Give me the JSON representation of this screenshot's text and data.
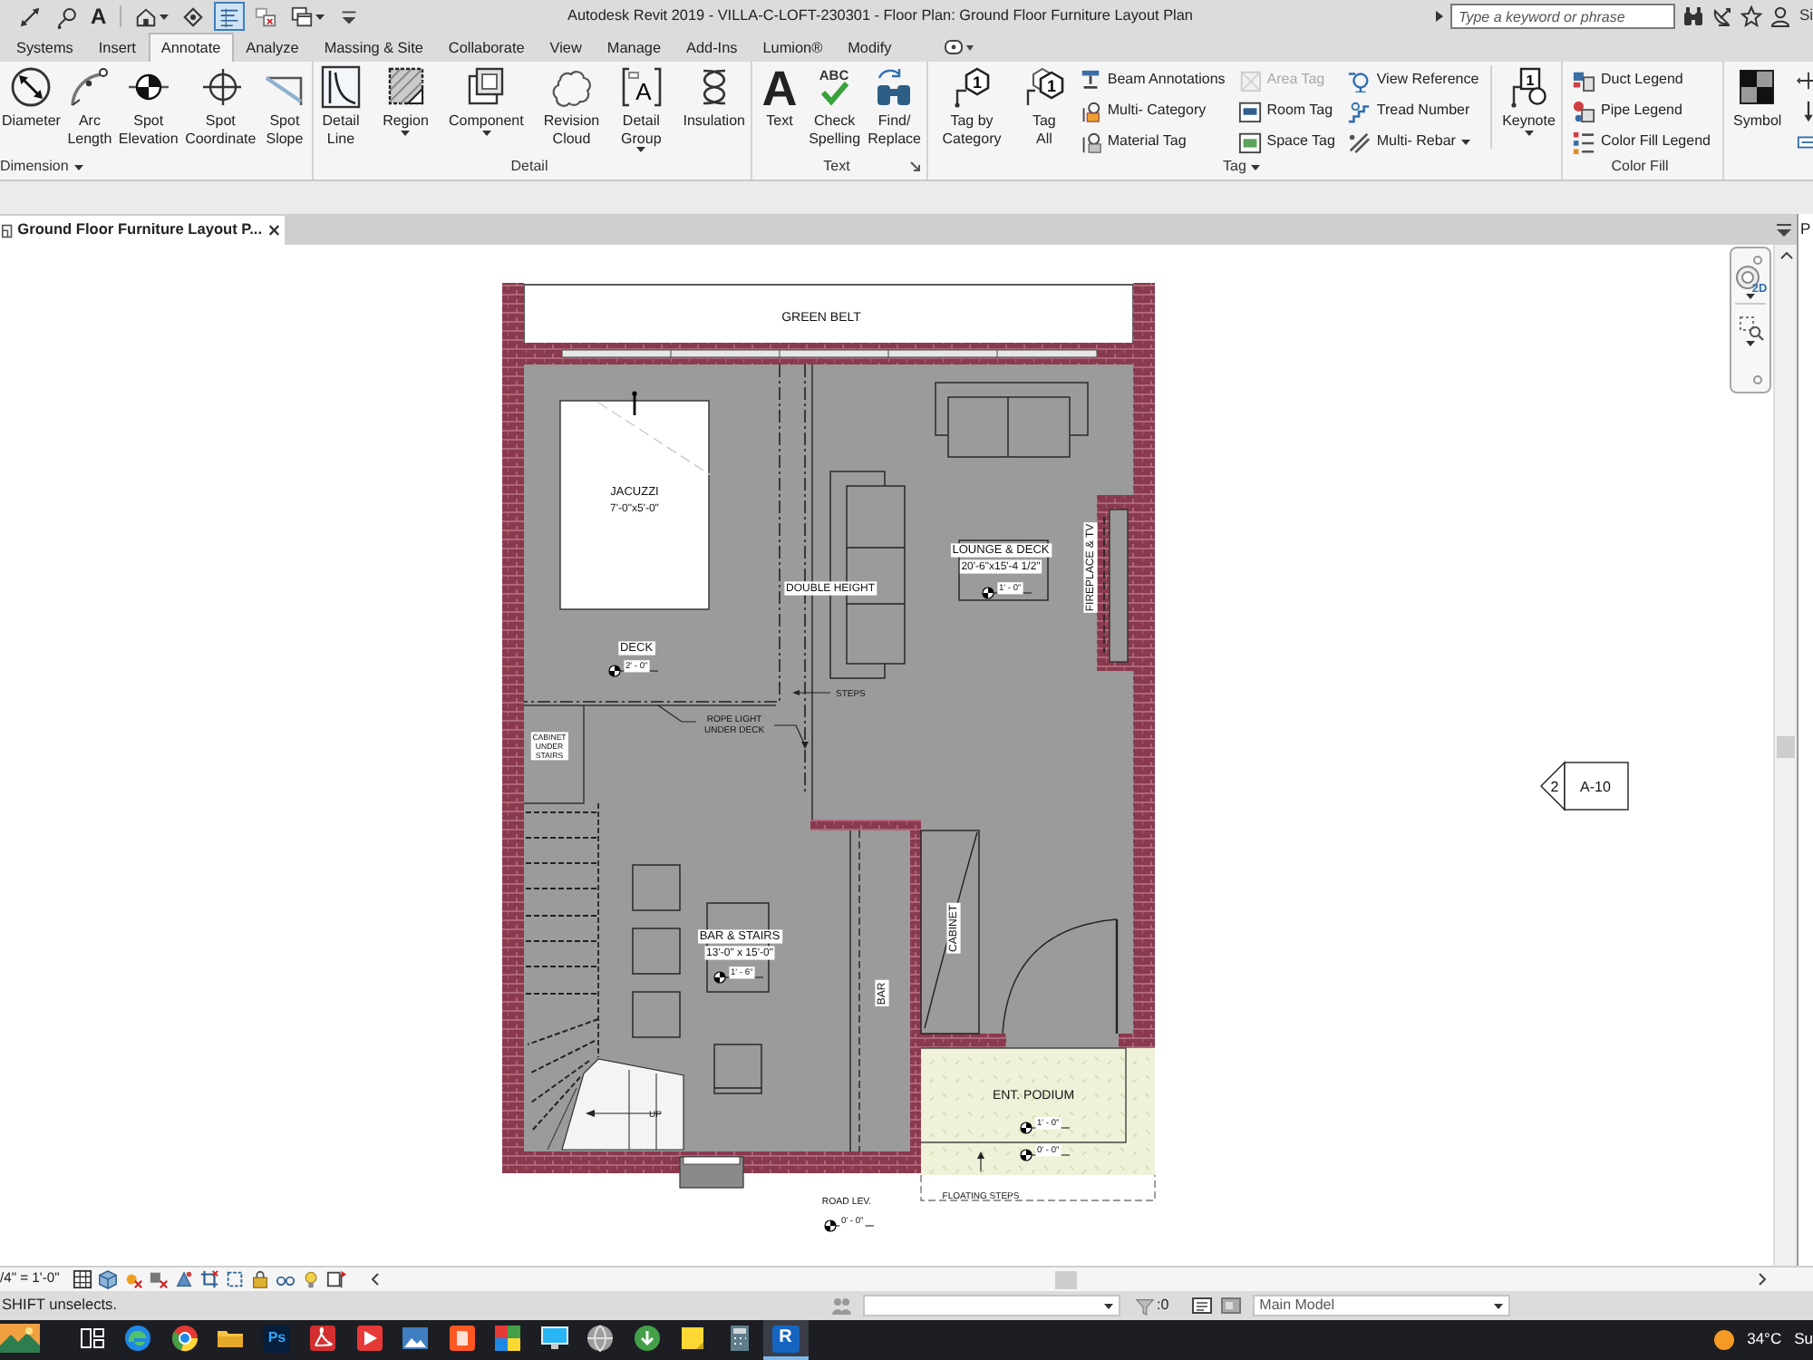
{
  "window": {
    "title": "Autodesk Revit 2019 - VILLA-C-LOFT-230301 - Floor Plan: Ground Floor Furniture Layout Plan"
  },
  "quick_access": [
    {
      "kind": "measure",
      "on": false
    },
    {
      "kind": "tag",
      "on": false
    },
    {
      "kind": "glyph",
      "glyph": "A",
      "on": false
    },
    {
      "kind": "house",
      "on": false
    },
    {
      "kind": "section",
      "on": false
    },
    {
      "kind": "thinlines",
      "on": true
    },
    {
      "kind": "closewin",
      "on": false
    },
    {
      "kind": "switchwin",
      "on": false
    },
    {
      "kind": "customize",
      "on": false
    }
  ],
  "search": {
    "placeholder": "Type a keyword or phrase"
  },
  "account": {
    "label": "Si"
  },
  "tabs": [
    {
      "label": "Systems",
      "selected": false
    },
    {
      "label": "Insert",
      "selected": false
    },
    {
      "label": "Annotate",
      "selected": true
    },
    {
      "label": "Analyze",
      "selected": false
    },
    {
      "label": "Massing & Site",
      "selected": false
    },
    {
      "label": "Collaborate",
      "selected": false
    },
    {
      "label": "View",
      "selected": false
    },
    {
      "label": "Manage",
      "selected": false
    },
    {
      "label": "Add-Ins",
      "selected": false
    },
    {
      "label": "Lumion®",
      "selected": false
    },
    {
      "label": "Modify",
      "selected": false
    }
  ],
  "ribbon": {
    "panels": [
      {
        "title": "Dimension",
        "menu": true,
        "launcher": false,
        "items": [
          {
            "kind": "diameter",
            "label": "Diameter",
            "dropdown": false
          },
          {
            "kind": "arc",
            "label": "Arc Length",
            "dropdown": false
          },
          {
            "kind": "elevation",
            "label": "Spot Elevation",
            "dropdown": false
          },
          {
            "kind": "coordinate",
            "label": "Spot Coordinate",
            "dropdown": false
          },
          {
            "kind": "slope",
            "label": "Spot Slope",
            "dropdown": false
          }
        ]
      },
      {
        "title": "Detail",
        "menu": false,
        "launcher": false,
        "items": [
          {
            "kind": "line",
            "label": "Detail Line",
            "dropdown": false
          },
          {
            "kind": "region",
            "label": "Region",
            "dropdown": true
          },
          {
            "kind": "component",
            "label": "Component",
            "dropdown": true
          },
          {
            "kind": "cloud",
            "label": "Revision Cloud",
            "dropdown": false
          },
          {
            "kind": "group",
            "glyph": "A",
            "label": "Detail Group",
            "dropdown": true
          },
          {
            "kind": "insulation",
            "label": "Insulation",
            "dropdown": false
          }
        ]
      },
      {
        "title": "Text",
        "menu": false,
        "launcher": true,
        "items": [
          {
            "kind": "text",
            "glyph": "A",
            "label": "Text",
            "dropdown": false
          },
          {
            "kind": "spelling",
            "glyph": "ABC",
            "label": "Check Spelling",
            "dropdown": false
          },
          {
            "kind": "find",
            "label": "Find/ Replace",
            "dropdown": false
          }
        ]
      },
      {
        "title": "Tag",
        "menu": true,
        "launcher": false,
        "items": [
          {
            "kind": "tagcategory",
            "glyph": "1",
            "label": "Tag by Category",
            "dropdown": false
          },
          {
            "kind": "tagall",
            "glyph": "1",
            "label": "Tag All",
            "dropdown": false
          },
          {
            "kind": "stack",
            "buttons": [
              {
                "kind": "beam",
                "label": "Beam Annotations",
                "disabled": false,
                "dropdown": false
              },
              {
                "kind": "multicat",
                "label": "Multi- Category",
                "disabled": false,
                "dropdown": false
              },
              {
                "kind": "material",
                "label": "Material Tag",
                "disabled": false,
                "dropdown": false
              }
            ]
          },
          {
            "kind": "stack",
            "buttons": [
              {
                "kind": "areatag",
                "label": "Area Tag",
                "disabled": true,
                "dropdown": false
              },
              {
                "kind": "roomtag",
                "label": "Room Tag",
                "disabled": false,
                "dropdown": false
              },
              {
                "kind": "spacetag",
                "label": "Space Tag",
                "disabled": false,
                "dropdown": false
              }
            ]
          },
          {
            "kind": "stack",
            "buttons": [
              {
                "kind": "viewref",
                "label": "View Reference",
                "disabled": false,
                "dropdown": false
              },
              {
                "kind": "tread",
                "label": "Tread Number",
                "disabled": false,
                "dropdown": false
              },
              {
                "kind": "multirebar",
                "label": "Multi- Rebar",
                "disabled": false,
                "dropdown": true
              }
            ]
          },
          {
            "kind": "separator"
          },
          {
            "kind": "keynote",
            "glyph": "1",
            "label": "Keynote",
            "dropdown": true
          }
        ]
      },
      {
        "title": "Color Fill",
        "menu": false,
        "launcher": false,
        "items": [
          {
            "kind": "stack",
            "buttons": [
              {
                "kind": "duct",
                "label": "Duct Legend",
                "disabled": false,
                "dropdown": false
              },
              {
                "kind": "pipe",
                "label": "Pipe Legend",
                "disabled": false,
                "dropdown": false
              },
              {
                "kind": "colorfill",
                "label": "Color Fill Legend",
                "disabled": false,
                "dropdown": false
              }
            ]
          }
        ]
      },
      {
        "items": [
          {
            "kind": "symbol",
            "label": "Symbol",
            "dropdown": false
          },
          {
            "kind": "stack",
            "buttons": [
              {
                "kind": "span",
                "disabled": false
              },
              {
                "kind": "path",
                "disabled": false
              },
              {
                "kind": "beamsym",
                "disabled": false
              }
            ]
          }
        ]
      }
    ]
  },
  "view_tabs": [
    {
      "label": "Ground Floor Furniture Layout P...",
      "selected": true
    }
  ],
  "side_panel": {
    "title": "P"
  },
  "navigation_bar": {
    "wheel_label": "2D"
  },
  "floor_plan": {
    "rooms": [
      {
        "name": "GREEN BELT"
      },
      {
        "name": "JACUZZI",
        "size": "7'-0\"x5'-0\""
      },
      {
        "name": "DECK",
        "elevation": "2' - 0\""
      },
      {
        "name": "LOUNGE & DECK",
        "size": "20'-6\"x15'-4 1/2\"",
        "elevation": "1' - 0\""
      },
      {
        "name": "BAR & STAIRS",
        "size": "13'-0\" x 15'-0\"",
        "elevation": "1' - 6\""
      },
      {
        "name": "ENT. PODIUM",
        "elevation": "1' - 0\""
      }
    ],
    "notes": [
      "DOUBLE HEIGHT",
      "STEPS",
      "ROPE LIGHT UNDER DECK",
      "CABINET UNDER STAIRS",
      "FIREPLACE & TV",
      "CABINET",
      "BAR",
      "UP",
      "FLOATING STEPS"
    ],
    "spot_elevations": [
      {
        "value": "0' - 0\""
      },
      {
        "label": "ROAD LEV.",
        "value": "0' - 0\""
      }
    ],
    "section_marker": {
      "number": "2",
      "sheet": "A-10"
    }
  },
  "view_control": {
    "scale": "/4\" = 1'-0\""
  },
  "status_bar": {
    "message": "SHIFT unselects.",
    "selection_count": ":0",
    "design_option": "Main Model"
  },
  "taskbar": {
    "apps": [
      {
        "kind": "widget",
        "active": false
      },
      {
        "kind": "taskview",
        "active": false
      },
      {
        "kind": "edge",
        "active": false
      },
      {
        "kind": "chrome",
        "active": false
      },
      {
        "kind": "explorer",
        "active": false
      },
      {
        "kind": "ps",
        "glyph": "Ps",
        "active": false
      },
      {
        "kind": "acrobat",
        "active": false
      },
      {
        "kind": "play",
        "active": false
      },
      {
        "kind": "photos",
        "active": false
      },
      {
        "kind": "doc",
        "active": false
      },
      {
        "kind": "squares",
        "active": false
      },
      {
        "kind": "monitor",
        "active": false
      },
      {
        "kind": "globe",
        "active": false
      },
      {
        "kind": "download",
        "active": false
      },
      {
        "kind": "sticky",
        "active": false
      },
      {
        "kind": "calc",
        "active": false
      },
      {
        "kind": "revit",
        "glyph": "R",
        "active": true
      }
    ],
    "weather": {
      "temperature": "34°C",
      "condition": "Su"
    }
  }
}
